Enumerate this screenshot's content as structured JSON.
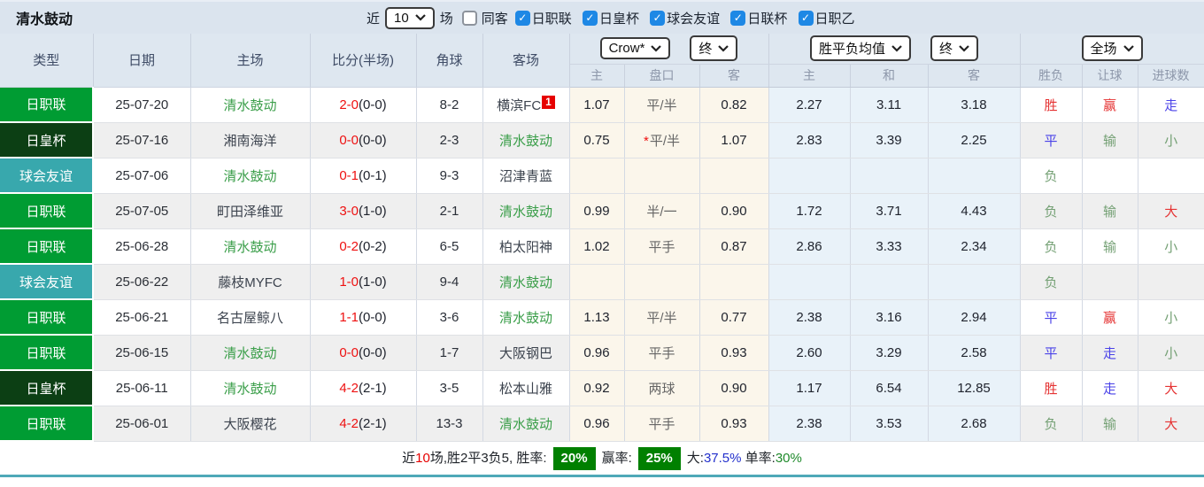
{
  "header": {
    "title": "清水鼓动",
    "recent_label": "近",
    "matches_select": "10",
    "matches_label": "场",
    "same_venue_label": "同客",
    "leagues": [
      {
        "label": "日职联",
        "checked": true
      },
      {
        "label": "日皇杯",
        "checked": true
      },
      {
        "label": "球会友谊",
        "checked": true
      },
      {
        "label": "日联杯",
        "checked": true
      },
      {
        "label": "日职乙",
        "checked": true
      }
    ]
  },
  "table": {
    "selects": {
      "bookmaker": "Crow*",
      "bookmaker_time": "终",
      "average": "胜平负均值",
      "average_time": "终",
      "scope": "全场"
    },
    "headers": [
      "类型",
      "日期",
      "主场",
      "比分(半场)",
      "角球",
      "客场"
    ],
    "sub_headers": [
      "主",
      "盘口",
      "客",
      "主",
      "和",
      "客",
      "胜负",
      "让球",
      "进球数"
    ],
    "rows": [
      {
        "league": "日职联",
        "league_color": "green",
        "date": "25-07-20",
        "home": "清水鼓动",
        "home_highlight": true,
        "score": "2-0",
        "half": "(0-0)",
        "corner": "8-2",
        "away": "横滨FC",
        "away_badge": "1",
        "away_highlight": false,
        "odds_home": "1.07",
        "handicap": "平/半",
        "handicap_star": false,
        "odds_away": "0.82",
        "avg_home": "2.27",
        "avg_draw": "3.11",
        "avg_away": "3.18",
        "result": "胜",
        "handicap_result": "赢",
        "goals_result": "走"
      },
      {
        "league": "日皇杯",
        "league_color": "darkgreen",
        "date": "25-07-16",
        "home": "湘南海洋",
        "home_highlight": false,
        "score": "0-0",
        "half": "(0-0)",
        "corner": "2-3",
        "away": "清水鼓动",
        "away_badge": "",
        "away_highlight": true,
        "odds_home": "0.75",
        "handicap": "平/半",
        "handicap_star": true,
        "odds_away": "1.07",
        "avg_home": "2.83",
        "avg_draw": "3.39",
        "avg_away": "2.25",
        "result": "平",
        "handicap_result": "输",
        "goals_result": "小"
      },
      {
        "league": "球会友谊",
        "league_color": "teal",
        "date": "25-07-06",
        "home": "清水鼓动",
        "home_highlight": true,
        "score": "0-1",
        "half": "(0-1)",
        "corner": "9-3",
        "away": "沼津青蓝",
        "away_badge": "",
        "away_highlight": false,
        "odds_home": "",
        "handicap": "",
        "handicap_star": false,
        "odds_away": "",
        "avg_home": "",
        "avg_draw": "",
        "avg_away": "",
        "result": "负",
        "handicap_result": "",
        "goals_result": ""
      },
      {
        "league": "日职联",
        "league_color": "green",
        "date": "25-07-05",
        "home": "町田泽维亚",
        "home_highlight": false,
        "score": "3-0",
        "half": "(1-0)",
        "corner": "2-1",
        "away": "清水鼓动",
        "away_badge": "",
        "away_highlight": true,
        "odds_home": "0.99",
        "handicap": "半/一",
        "handicap_star": false,
        "odds_away": "0.90",
        "avg_home": "1.72",
        "avg_draw": "3.71",
        "avg_away": "4.43",
        "result": "负",
        "handicap_result": "输",
        "goals_result": "大"
      },
      {
        "league": "日职联",
        "league_color": "green",
        "date": "25-06-28",
        "home": "清水鼓动",
        "home_highlight": true,
        "score": "0-2",
        "half": "(0-2)",
        "corner": "6-5",
        "away": "柏太阳神",
        "away_badge": "",
        "away_highlight": false,
        "odds_home": "1.02",
        "handicap": "平手",
        "handicap_star": false,
        "odds_away": "0.87",
        "avg_home": "2.86",
        "avg_draw": "3.33",
        "avg_away": "2.34",
        "result": "负",
        "handicap_result": "输",
        "goals_result": "小"
      },
      {
        "league": "球会友谊",
        "league_color": "teal",
        "date": "25-06-22",
        "home": "藤枝MYFC",
        "home_highlight": false,
        "score": "1-0",
        "half": "(1-0)",
        "corner": "9-4",
        "away": "清水鼓动",
        "away_badge": "",
        "away_highlight": true,
        "odds_home": "",
        "handicap": "",
        "handicap_star": false,
        "odds_away": "",
        "avg_home": "",
        "avg_draw": "",
        "avg_away": "",
        "result": "负",
        "handicap_result": "",
        "goals_result": ""
      },
      {
        "league": "日职联",
        "league_color": "green",
        "date": "25-06-21",
        "home": "名古屋鲸八",
        "home_highlight": false,
        "score": "1-1",
        "half": "(0-0)",
        "corner": "3-6",
        "away": "清水鼓动",
        "away_badge": "",
        "away_highlight": true,
        "odds_home": "1.13",
        "handicap": "平/半",
        "handicap_star": false,
        "odds_away": "0.77",
        "avg_home": "2.38",
        "avg_draw": "3.16",
        "avg_away": "2.94",
        "result": "平",
        "handicap_result": "赢",
        "goals_result": "小"
      },
      {
        "league": "日职联",
        "league_color": "green",
        "date": "25-06-15",
        "home": "清水鼓动",
        "home_highlight": true,
        "score": "0-0",
        "half": "(0-0)",
        "corner": "1-7",
        "away": "大阪钢巴",
        "away_badge": "",
        "away_highlight": false,
        "odds_home": "0.96",
        "handicap": "平手",
        "handicap_star": false,
        "odds_away": "0.93",
        "avg_home": "2.60",
        "avg_draw": "3.29",
        "avg_away": "2.58",
        "result": "平",
        "handicap_result": "走",
        "goals_result": "小"
      },
      {
        "league": "日皇杯",
        "league_color": "darkgreen",
        "date": "25-06-11",
        "home": "清水鼓动",
        "home_highlight": true,
        "score": "4-2",
        "half": "(2-1)",
        "corner": "3-5",
        "away": "松本山雅",
        "away_badge": "",
        "away_highlight": false,
        "odds_home": "0.92",
        "handicap": "两球",
        "handicap_star": false,
        "odds_away": "0.90",
        "avg_home": "1.17",
        "avg_draw": "6.54",
        "avg_away": "12.85",
        "result": "胜",
        "handicap_result": "走",
        "goals_result": "大"
      },
      {
        "league": "日职联",
        "league_color": "green",
        "date": "25-06-01",
        "home": "大阪樱花",
        "home_highlight": false,
        "score": "4-2",
        "half": "(2-1)",
        "corner": "13-3",
        "away": "清水鼓动",
        "away_badge": "",
        "away_highlight": true,
        "odds_home": "0.96",
        "handicap": "平手",
        "handicap_star": false,
        "odds_away": "0.93",
        "avg_home": "2.38",
        "avg_draw": "3.53",
        "avg_away": "2.68",
        "result": "负",
        "handicap_result": "输",
        "goals_result": "大"
      }
    ]
  },
  "result_color_map": {
    "胜": "red",
    "平": "blue",
    "负": "green",
    "赢": "red",
    "输": "green",
    "走": "blue",
    "大": "red",
    "小": "green"
  },
  "colors": {
    "leagues": {
      "green": "#009c33",
      "darkgreen": "#0c3f14",
      "teal": "#38a8ad"
    },
    "checkbox_blue": "#1e88e5",
    "badge_green": "#008000",
    "team_highlight": "#3a9e49",
    "score_red": "#ee1111"
  },
  "footer": {
    "segments": [
      {
        "text": "近",
        "style": "plain"
      },
      {
        "text": "10",
        "style": "red"
      },
      {
        "text": "场,胜2平3负5, 胜率:",
        "style": "plain"
      },
      {
        "text": "20%",
        "style": "badge"
      },
      {
        "text": "赢率:",
        "style": "plain"
      },
      {
        "text": "25%",
        "style": "badge"
      },
      {
        "text": "大:",
        "style": "plain"
      },
      {
        "text": "37.5%",
        "style": "blue"
      },
      {
        "text": " 单率:",
        "style": "plain"
      },
      {
        "text": "30%",
        "style": "green"
      }
    ]
  }
}
